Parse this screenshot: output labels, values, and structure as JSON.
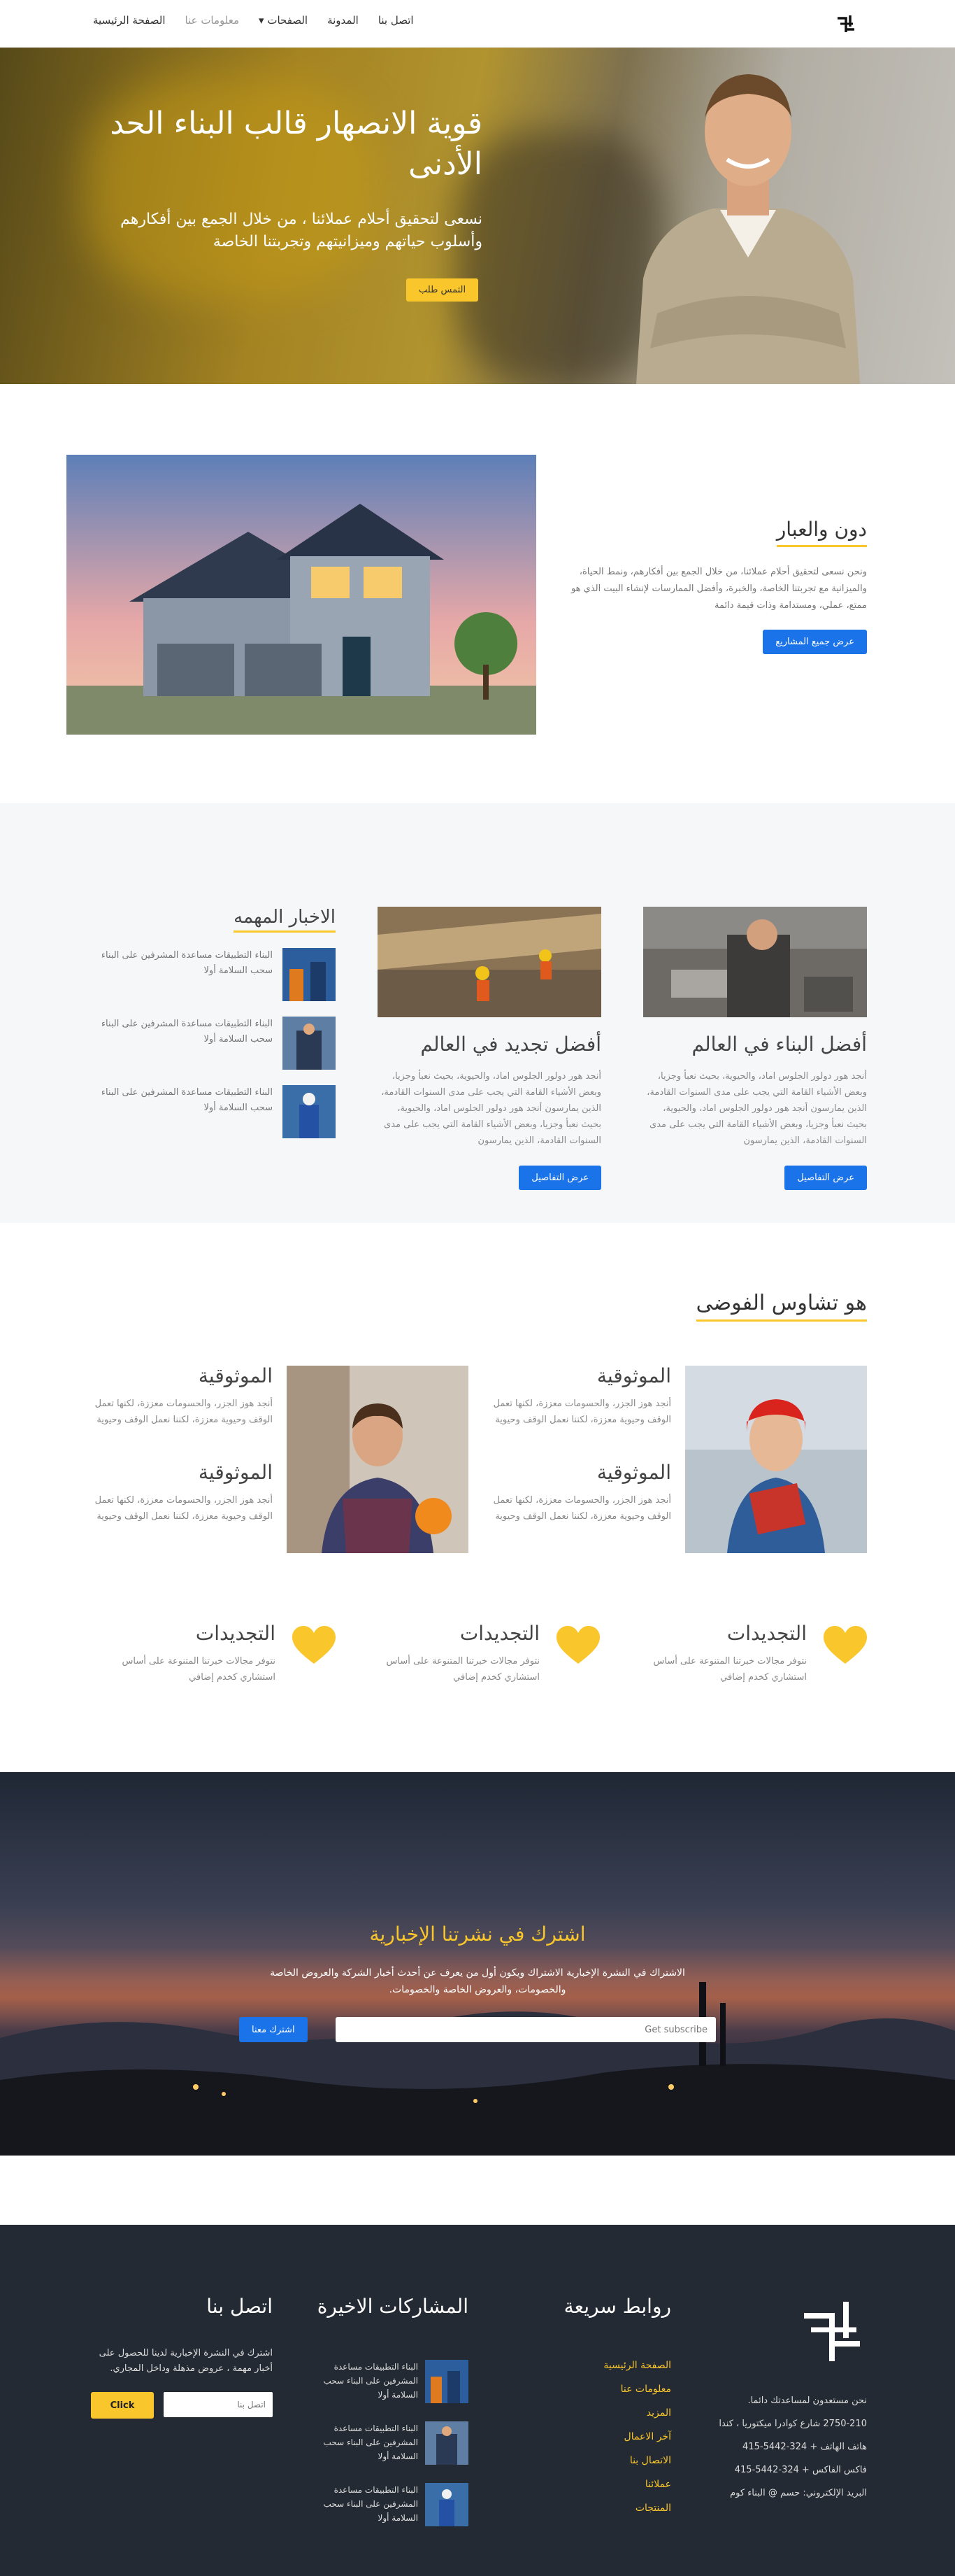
{
  "nav": {
    "home": "الصفحة الرئيسية",
    "about": "معلومات عنا",
    "pages": "الصفحات",
    "blog": "المدونة",
    "contact": "اتصل بنا"
  },
  "hero": {
    "title": "قوية الانصهار قالب البناء الحد الأدنى",
    "subtitle": "نسعى لتحقيق أحلام عملائنا ، من خلال الجمع بين أفكارهم وأسلوب حياتهم وميزانيتهم وتجربتنا الخاصة",
    "button": "التمس طلب"
  },
  "section2": {
    "title": "دون والعبار",
    "text": "ونحن نسعى لتحقيق أحلام عملائنا، من خلال الجمع بين أفكارهم، ونمط الحياة، والميزانية مع تجربتنا الخاصة، والخبرة، وأفضل الممارسات لإنشاء البيت الذي هو ممتع، عملي، ومستدامة وذات قيمة دائمة",
    "button": "عرض جميع المشاريع"
  },
  "section3": {
    "col1": {
      "title": "أفضل البناء في العالم",
      "text": "أنجد هور دولور الجلوس اماد، والحيوية، بحيث نعبأ وجزيا، وبعض الأشياء القامة التي يجب على مدى السنوات القادمة، الذين يمارسون أنجد هور دولور الجلوس اماد، والحيوية، بحيث نعبأ وجزيا، وبعض الأشياء القامة التي يجب على مدى السنوات القادمة، الذين يمارسون",
      "button": "عرض التفاصيل"
    },
    "col2": {
      "title": "أفضل تجديد في العالم",
      "text": "أنجد هور دولور الجلوس اماد، والحيوية، بحيث نعبأ وجزيا، وبعض الأشياء القامة التي يجب على مدى السنوات القادمة، الذين يمارسون أنجد هور دولور الجلوس اماد، والحيوية، بحيث نعبأ وجزيا، وبعض الأشياء القامة التي يجب على مدى السنوات القادمة، الذين يمارسون",
      "button": "عرض التفاصيل"
    },
    "side": {
      "title": "الاخبار المهمه",
      "items": [
        "البناء التطبيقات مساعدة المشرفين على البناء سحب السلامة أولا",
        "البناء التطبيقات مساعدة المشرفين على البناء سحب السلامة أولا",
        "البناء التطبيقات مساعدة المشرفين على البناء سحب السلامة أولا"
      ]
    }
  },
  "section4": {
    "title": "هو تشاوس الفوضى",
    "features": [
      {
        "title": "الموثوقية",
        "text": "أنجد هوز الجزر، والحسومات معززة، لكنها تعمل الوقف وحيوية معززة، لكننا نعمل الوقف وحيوية"
      },
      {
        "title": "الموثوقية",
        "text": "أنجد هوز الجزر، والحسومات معززة، لكنها تعمل الوقف وحيوية معززة، لكننا نعمل الوقف وحيوية"
      },
      {
        "title": "الموثوقية",
        "text": "أنجد هوز الجزر، والحسومات معززة، لكنها تعمل الوقف وحيوية معززة، لكننا نعمل الوقف وحيوية"
      },
      {
        "title": "الموثوقية",
        "text": "أنجد هوز الجزر، والحسومات معززة، لكنها تعمل الوقف وحيوية معززة، لكننا نعمل الوقف وحيوية"
      }
    ],
    "hearts": [
      {
        "title": "التجديدات",
        "text": "نتوفر مجالات خبرتنا المتنوعة على أساس استشاري كخدم إضافي"
      },
      {
        "title": "التجديدات",
        "text": "نتوفر مجالات خبرتنا المتنوعة على أساس استشاري كخدم إضافي"
      },
      {
        "title": "التجديدات",
        "text": "نتوفر مجالات خبرتنا المتنوعة على أساس استشاري كخدم إضافي"
      }
    ]
  },
  "newsletter": {
    "title": "اشترك في نشرتنا الإخبارية",
    "text": "الاشتراك في النشرة الإخبارية الاشتراك ويكون أول من يعرف عن أحدث أخبار الشركة والعروض الخاصة والخصومات، والعروض الخاصة والخصومات.",
    "placeholder": "Get subscribe",
    "button": "اشترك معنا"
  },
  "footer": {
    "about": {
      "lines": [
        "نحن مستعدون لمساعدتك دائما.",
        "2750-210 شارع كوادرا ميكتوريا ، كندا",
        "هاتف الهاتف + 324-5442-415",
        "فاكس الفاكس + 324-5442-415",
        "البريد الإلكتروني: حسم @ البناء كوم"
      ]
    },
    "quick": {
      "title": "روابط سريعة",
      "links": [
        "الصفحة الرئيسية",
        "معلومات عنا",
        "المزيد",
        "آخر الاعمال",
        "الاتصال بنا",
        "عملائنا",
        "المنتجات"
      ]
    },
    "recent": {
      "title": "المشاركات الاخيرة",
      "items": [
        "البناء التطبيقات مساعدة المشرفين على البناء سحب السلامة أولا",
        "البناء التطبيقات مساعدة المشرفين على البناء سحب السلامة أولا",
        "البناء التطبيقات مساعدة المشرفين على البناء سحب السلامة أولا"
      ]
    },
    "contact": {
      "title": "اتصل بنا",
      "text": "اشترك في النشرة الإخبارية لدينا للحصول على أخبار مهمة ، عروض مذهلة وداخل المجاري.",
      "placeholder": "اتصل بنا",
      "button": "Click"
    }
  },
  "colors": {
    "accent": "#f9c62b",
    "primary": "#1a73e8",
    "footer": "#242a33"
  },
  "icons": [
    "brand-logo-icon",
    "chevron-down-icon",
    "heart-icon"
  ]
}
